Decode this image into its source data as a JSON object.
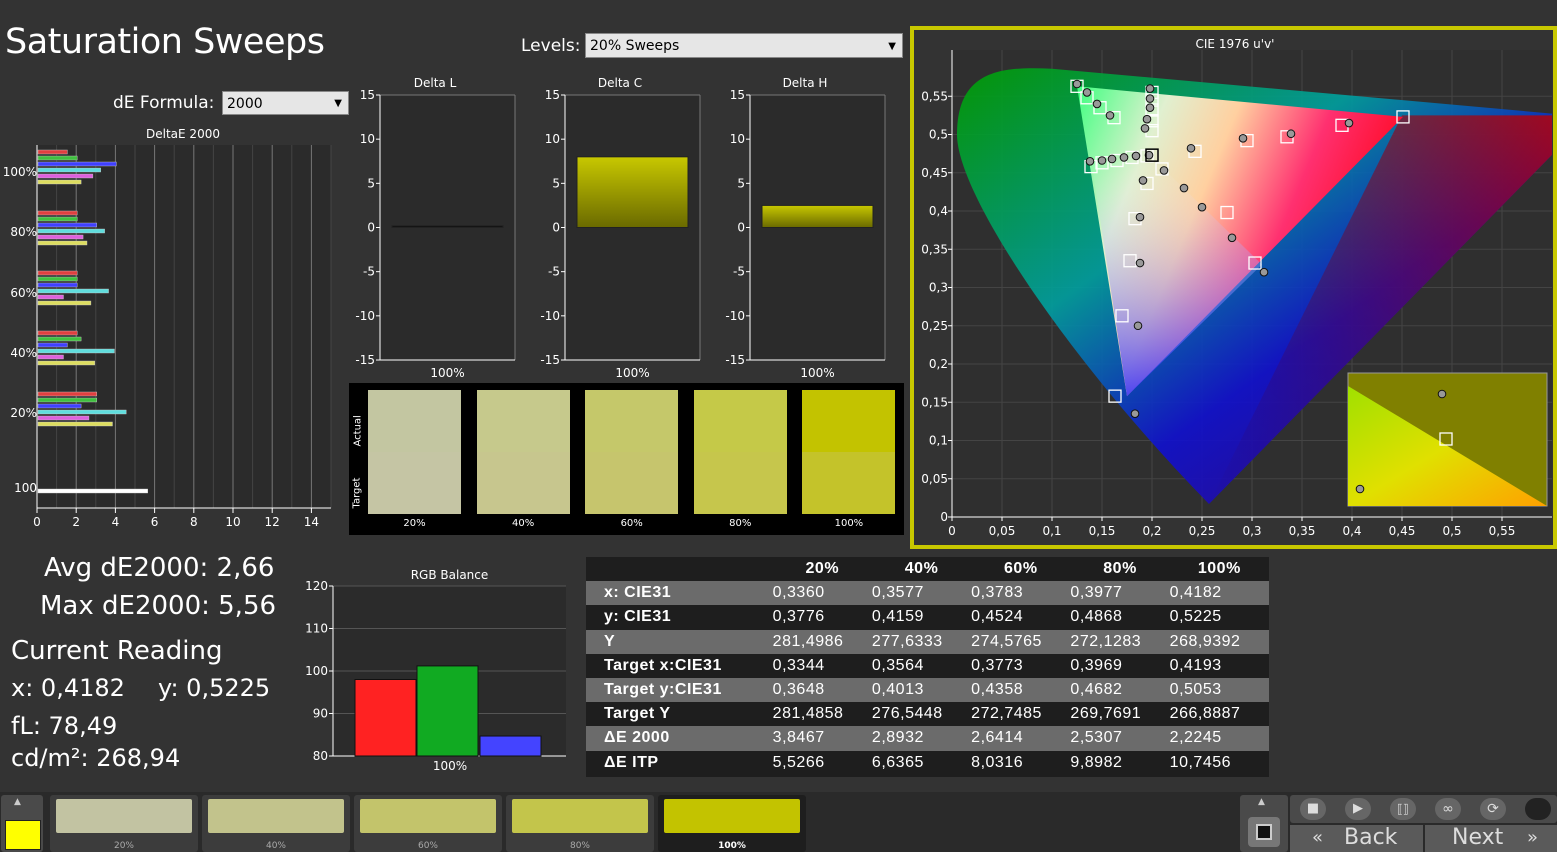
{
  "header": {
    "title": "Saturation Sweeps",
    "levels_label": "Levels:",
    "levels_value": "20% Sweeps",
    "de_formula_label": "dE Formula:",
    "de_formula_value": "2000"
  },
  "deltae_chart": {
    "title": "DeltaE 2000",
    "x_ticks": [
      "0",
      "2",
      "4",
      "6",
      "8",
      "10",
      "12",
      "14"
    ],
    "y_labels": [
      "100%",
      "80%",
      "60%",
      "40%",
      "20%",
      "100"
    ]
  },
  "delta_panels": [
    {
      "title": "Delta L",
      "value": 0.2,
      "color": "#111111",
      "category": "100%"
    },
    {
      "title": "Delta C",
      "value": 8.0,
      "color": "#c8c800",
      "category": "100%"
    },
    {
      "title": "Delta H",
      "value": 2.5,
      "color": "#c8c800",
      "category": "100%"
    }
  ],
  "delta_ticks": [
    "15",
    "10",
    "5",
    "0",
    "-5",
    "-10",
    "-15"
  ],
  "swatches": {
    "actual_label": "Actual",
    "target_label": "Target",
    "items": [
      {
        "label": "20%",
        "actual": "#c3c6a1",
        "target": "#c5c5a4"
      },
      {
        "label": "40%",
        "actual": "#c6c98c",
        "target": "#c7c68e"
      },
      {
        "label": "60%",
        "actual": "#c5c86a",
        "target": "#c6c56d"
      },
      {
        "label": "80%",
        "actual": "#c5c948",
        "target": "#c6c64c"
      },
      {
        "label": "100%",
        "actual": "#c3c300",
        "target": "#c4c32a"
      }
    ]
  },
  "cie": {
    "title": "CIE 1976 u'v'",
    "x_ticks": [
      "0",
      "0,05",
      "0,1",
      "0,15",
      "0,2",
      "0,25",
      "0,3",
      "0,35",
      "0,4",
      "0,45",
      "0,5",
      "0,55"
    ],
    "y_ticks": [
      "0",
      "0,05",
      "0,1",
      "0,15",
      "0,2",
      "0,25",
      "0,3",
      "0,35",
      "0,4",
      "0,45",
      "0,5",
      "0,55"
    ]
  },
  "summary": {
    "avg": "Avg dE2000: 2,66",
    "max": "Max dE2000: 5,56",
    "current_reading": "Current Reading",
    "x": "x: 0,4182",
    "y": "y: 0,5225",
    "fl": "fL: 78,49",
    "cdm2": "cd/m²: 268,94"
  },
  "rgb_balance": {
    "title": "RGB Balance",
    "y_ticks": [
      "120",
      "110",
      "100",
      "90",
      "80"
    ],
    "ylim": [
      80,
      120
    ],
    "category": "100%",
    "bars": [
      {
        "name": "R",
        "value": 98,
        "color": "#ff2222"
      },
      {
        "name": "G",
        "value": 101.2,
        "color": "#11aa22"
      },
      {
        "name": "B",
        "value": 84.7,
        "color": "#4444ff"
      }
    ]
  },
  "table": {
    "columns": [
      "20%",
      "40%",
      "60%",
      "80%",
      "100%"
    ],
    "rows": [
      {
        "label": "x: CIE31",
        "values": [
          "0,3360",
          "0,3577",
          "0,3783",
          "0,3977",
          "0,4182"
        ]
      },
      {
        "label": "y: CIE31",
        "values": [
          "0,3776",
          "0,4159",
          "0,4524",
          "0,4868",
          "0,5225"
        ]
      },
      {
        "label": "Y",
        "values": [
          "281,4986",
          "277,6333",
          "274,5765",
          "272,1283",
          "268,9392"
        ]
      },
      {
        "label": "Target x:CIE31",
        "values": [
          "0,3344",
          "0,3564",
          "0,3773",
          "0,3969",
          "0,4193"
        ]
      },
      {
        "label": "Target y:CIE31",
        "values": [
          "0,3648",
          "0,4013",
          "0,4358",
          "0,4682",
          "0,5053"
        ]
      },
      {
        "label": "Target Y",
        "values": [
          "281,4858",
          "276,5448",
          "272,7485",
          "269,7691",
          "266,8887"
        ]
      },
      {
        "label": "ΔE 2000",
        "values": [
          "3,8467",
          "2,8932",
          "2,6414",
          "2,5307",
          "2,2245"
        ]
      },
      {
        "label": "ΔE ITP",
        "values": [
          "5,5266",
          "6,6365",
          "8,0316",
          "9,8982",
          "10,7456"
        ]
      }
    ]
  },
  "bottom": {
    "thumbs": [
      {
        "label": "20%",
        "color": "#c2c3a2"
      },
      {
        "label": "40%",
        "color": "#c2c38c"
      },
      {
        "label": "60%",
        "color": "#c3c46b"
      },
      {
        "label": "80%",
        "color": "#c3c54b"
      },
      {
        "label": "100%",
        "color": "#c3c300"
      }
    ],
    "current_color": "#ffff00",
    "back_label": "Back",
    "next_label": "Next"
  },
  "chart_data": [
    {
      "type": "bar",
      "title": "DeltaE 2000",
      "xlim": [
        0,
        15
      ],
      "groups": [
        "100%",
        "80%",
        "60%",
        "40%",
        "20%",
        "100"
      ],
      "series_colors": [
        "#e04040",
        "#40c040",
        "#4040ff",
        "#60dddd",
        "#dd60dd",
        "#dddd60"
      ],
      "values": [
        [
          1.5,
          2.0,
          4.0,
          3.2,
          2.8,
          2.2
        ],
        [
          2.0,
          2.0,
          3.0,
          3.4,
          2.3,
          2.5
        ],
        [
          2.0,
          2.0,
          2.0,
          3.6,
          1.3,
          2.7
        ],
        [
          2.0,
          2.2,
          1.5,
          3.9,
          1.3,
          2.9
        ],
        [
          3.0,
          3.0,
          2.2,
          4.5,
          2.6,
          3.8
        ],
        [
          5.6
        ]
      ]
    },
    {
      "type": "scatter",
      "title": "CIE 1976 u'v'",
      "xlim": [
        0,
        0.6
      ],
      "ylim": [
        0,
        0.6
      ],
      "primaries_triangle": [
        [
          0.451,
          0.523
        ],
        [
          0.125,
          0.563
        ],
        [
          0.175,
          0.158
        ]
      ],
      "targets": [
        [
          0.125,
          0.563
        ],
        [
          0.135,
          0.548
        ],
        [
          0.148,
          0.535
        ],
        [
          0.162,
          0.522
        ],
        [
          0.2,
          0.555
        ],
        [
          0.2,
          0.545
        ],
        [
          0.2,
          0.532
        ],
        [
          0.2,
          0.518
        ],
        [
          0.2,
          0.505
        ],
        [
          0.139,
          0.458
        ],
        [
          0.15,
          0.463
        ],
        [
          0.165,
          0.466
        ],
        [
          0.18,
          0.47
        ],
        [
          0.195,
          0.472
        ],
        [
          0.2,
          0.473
        ],
        [
          0.21,
          0.455
        ],
        [
          0.195,
          0.436
        ],
        [
          0.183,
          0.39
        ],
        [
          0.178,
          0.335
        ],
        [
          0.243,
          0.478
        ],
        [
          0.275,
          0.398
        ],
        [
          0.295,
          0.492
        ],
        [
          0.335,
          0.497
        ],
        [
          0.39,
          0.512
        ],
        [
          0.451,
          0.523
        ],
        [
          0.303,
          0.332
        ],
        [
          0.17,
          0.263
        ],
        [
          0.163,
          0.158
        ]
      ],
      "measured": [
        [
          0.125,
          0.566
        ],
        [
          0.135,
          0.555
        ],
        [
          0.145,
          0.54
        ],
        [
          0.158,
          0.525
        ],
        [
          0.198,
          0.56
        ],
        [
          0.198,
          0.547
        ],
        [
          0.198,
          0.535
        ],
        [
          0.195,
          0.52
        ],
        [
          0.193,
          0.508
        ],
        [
          0.138,
          0.465
        ],
        [
          0.15,
          0.466
        ],
        [
          0.16,
          0.468
        ],
        [
          0.172,
          0.47
        ],
        [
          0.184,
          0.472
        ],
        [
          0.197,
          0.473
        ],
        [
          0.212,
          0.453
        ],
        [
          0.191,
          0.44
        ],
        [
          0.232,
          0.43
        ],
        [
          0.25,
          0.405
        ],
        [
          0.239,
          0.482
        ],
        [
          0.291,
          0.495
        ],
        [
          0.339,
          0.501
        ],
        [
          0.397,
          0.515
        ],
        [
          0.188,
          0.392
        ],
        [
          0.188,
          0.332
        ],
        [
          0.28,
          0.365
        ],
        [
          0.312,
          0.32
        ],
        [
          0.186,
          0.25
        ],
        [
          0.183,
          0.135
        ]
      ]
    },
    {
      "type": "bar",
      "title": "RGB Balance",
      "categories": [
        "100%"
      ],
      "series": [
        {
          "name": "R",
          "values": [
            98
          ]
        },
        {
          "name": "G",
          "values": [
            101.2
          ]
        },
        {
          "name": "B",
          "values": [
            84.7
          ]
        }
      ],
      "ylim": [
        80,
        120
      ]
    }
  ]
}
